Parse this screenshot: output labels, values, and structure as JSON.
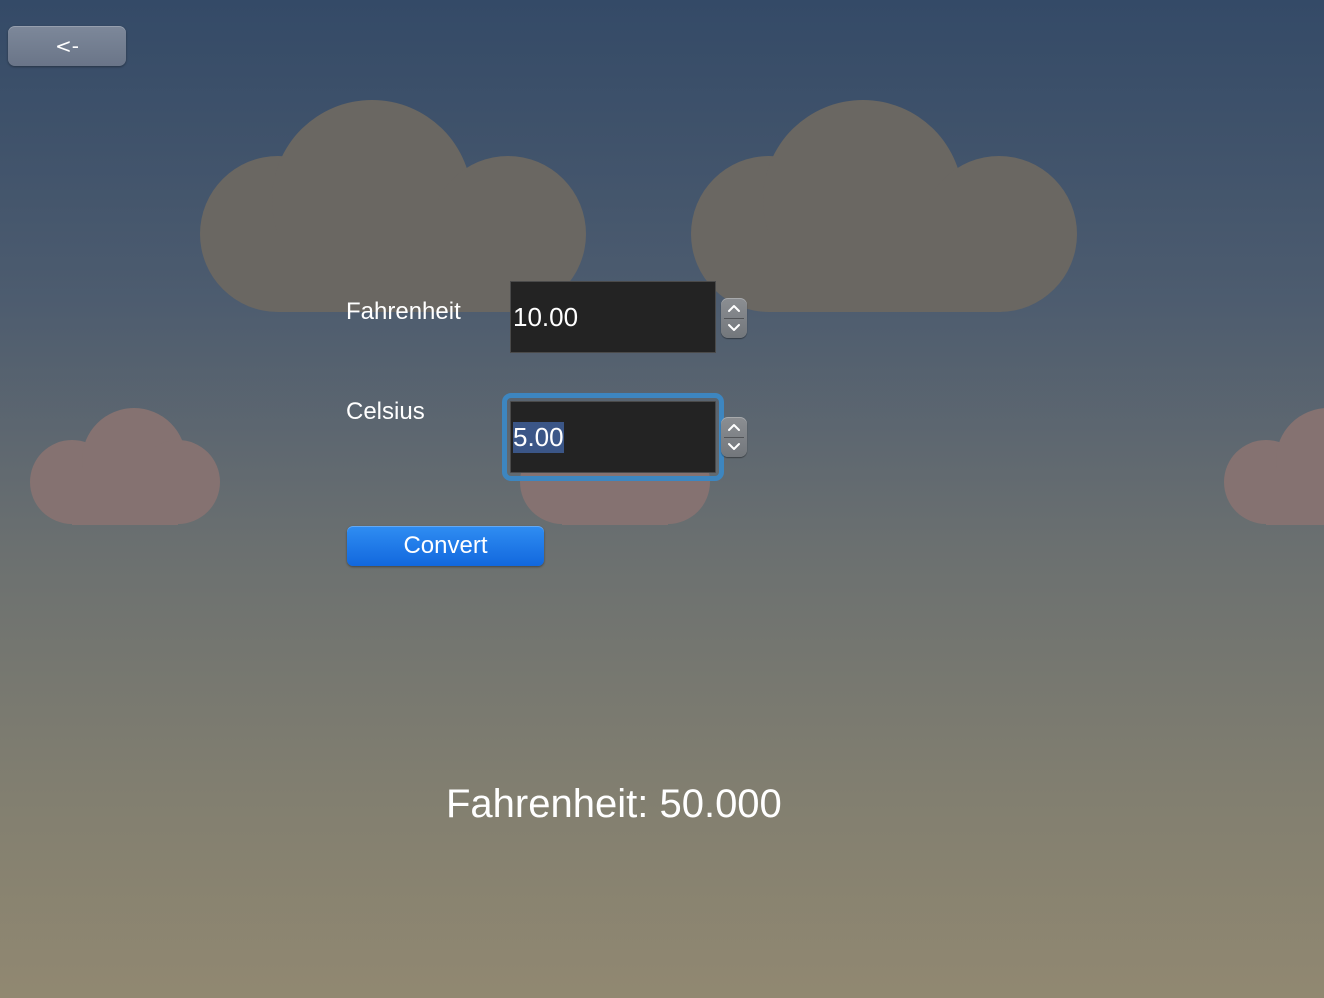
{
  "navigation": {
    "back_label": "<-"
  },
  "form": {
    "fahrenheit_label": "Fahrenheit",
    "fahrenheit_value": "10.00",
    "celsius_label": "Celsius",
    "celsius_value": "5.00",
    "convert_label": "Convert"
  },
  "result": {
    "text": "Fahrenheit: 50.000"
  },
  "icons": {
    "stepper_up": "chevron-up-icon",
    "stepper_down": "chevron-down-icon"
  },
  "colors": {
    "accent": "#1b74e8",
    "focus_ring": "#3d86c0",
    "field_bg": "#232323",
    "selection": "#3b5687"
  }
}
